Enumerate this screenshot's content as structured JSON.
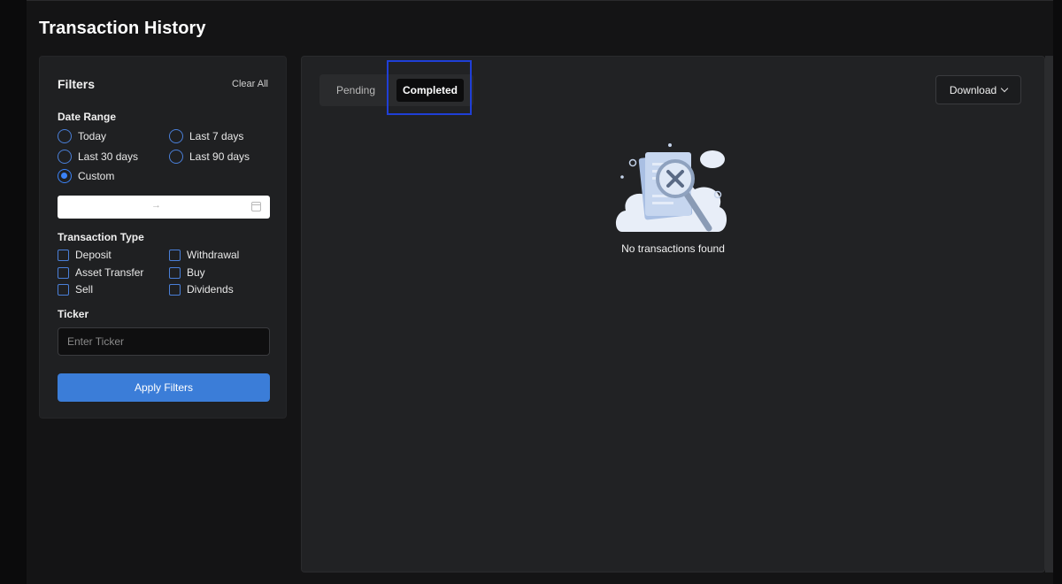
{
  "page": {
    "title": "Transaction History"
  },
  "filters": {
    "title": "Filters",
    "clear_all": "Clear All",
    "date_range": {
      "label": "Date Range",
      "options": [
        "Today",
        "Last 7 days",
        "Last 30 days",
        "Last 90 days",
        "Custom"
      ],
      "selected": "Custom",
      "separator_glyph": "→"
    },
    "transaction_type": {
      "label": "Transaction Type",
      "options": [
        "Deposit",
        "Withdrawal",
        "Asset Transfer",
        "Buy",
        "Sell",
        "Dividends"
      ]
    },
    "ticker": {
      "label": "Ticker",
      "placeholder": "Enter Ticker",
      "value": ""
    },
    "apply_label": "Apply Filters"
  },
  "main": {
    "tabs": [
      {
        "label": "Pending",
        "active": false
      },
      {
        "label": "Completed",
        "active": true
      }
    ],
    "download_label": "Download",
    "empty_message": "No transactions found"
  },
  "colors": {
    "accent": "#3b7dd8",
    "radio_selected": "#3b82f6",
    "highlight": "#1f3fd6",
    "panel": "#1f2022",
    "main_panel": "#212224"
  },
  "icons": {
    "date_picker": "calendar-icon",
    "download": "chevron-down-icon",
    "empty_state": "no-results-magnifier-icon"
  }
}
